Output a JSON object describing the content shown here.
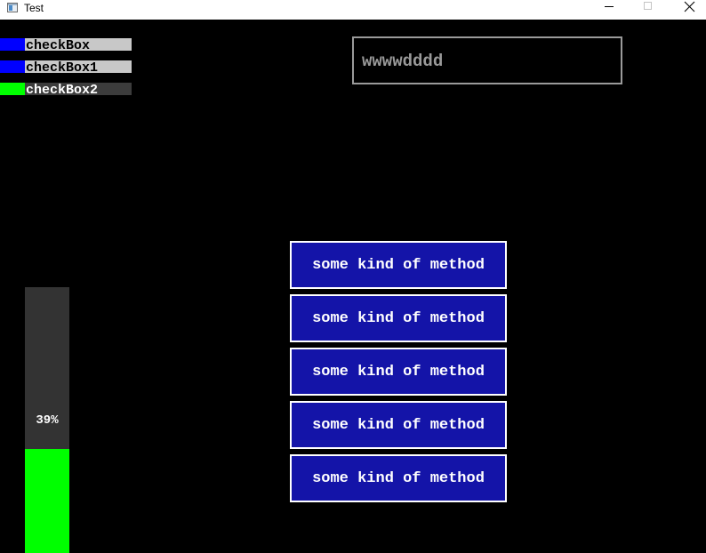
{
  "window": {
    "title": "Test"
  },
  "checkboxes": [
    {
      "label": "checkBox",
      "checked": false,
      "box_color": "#0000ff",
      "label_bg": "#c8c8c8",
      "label_color": "#000000"
    },
    {
      "label": "checkBox1",
      "checked": false,
      "box_color": "#0000ff",
      "label_bg": "#c8c8c8",
      "label_color": "#000000"
    },
    {
      "label": "checkBox2",
      "checked": true,
      "box_color": "#00ff00",
      "label_bg": "#3c3c3c",
      "label_color": "#ffffff"
    }
  ],
  "text_input": {
    "value": "wwwwdddd"
  },
  "buttons": [
    {
      "label": "some kind of method"
    },
    {
      "label": "some kind of method"
    },
    {
      "label": "some kind of method"
    },
    {
      "label": "some kind of method"
    },
    {
      "label": "some kind of method"
    }
  ],
  "progress": {
    "label": "39%",
    "value": 0.39,
    "fill_color": "#00ff00",
    "track_color": "#333333"
  },
  "colors": {
    "background": "#000000",
    "button_bg": "#1414a8",
    "button_border": "#ffffff",
    "input_border": "#9a9a9a"
  }
}
